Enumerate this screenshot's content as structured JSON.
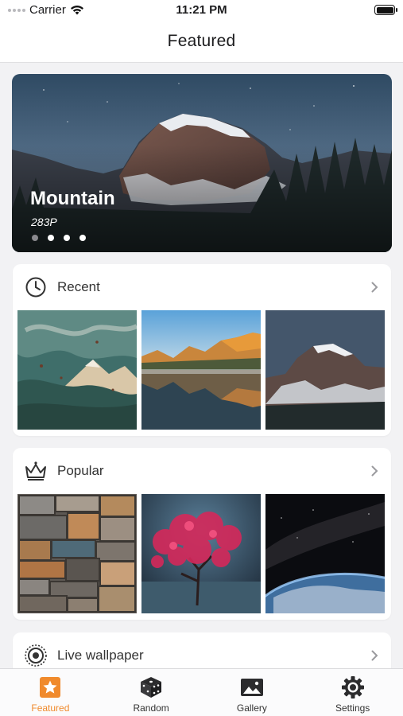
{
  "status_bar": {
    "carrier": "Carrier",
    "time": "11:21 PM"
  },
  "nav": {
    "title": "Featured"
  },
  "hero": {
    "title": "Mountain",
    "subtitle": "283P",
    "page_count": 4,
    "active_page": 0
  },
  "sections": [
    {
      "label": "Recent",
      "icon": "clock-icon"
    },
    {
      "label": "Popular",
      "icon": "crown-icon"
    },
    {
      "label": "Live wallpaper",
      "icon": "live-photo-icon"
    }
  ],
  "tabs": [
    {
      "label": "Featured",
      "icon": "star-icon",
      "active": true
    },
    {
      "label": "Random",
      "icon": "dice-icon",
      "active": false
    },
    {
      "label": "Gallery",
      "icon": "photo-icon",
      "active": false
    },
    {
      "label": "Settings",
      "icon": "gear-icon",
      "active": false
    }
  ],
  "colors": {
    "accent": "#f08a2c",
    "background": "#f2f2f4",
    "card": "#ffffff"
  }
}
